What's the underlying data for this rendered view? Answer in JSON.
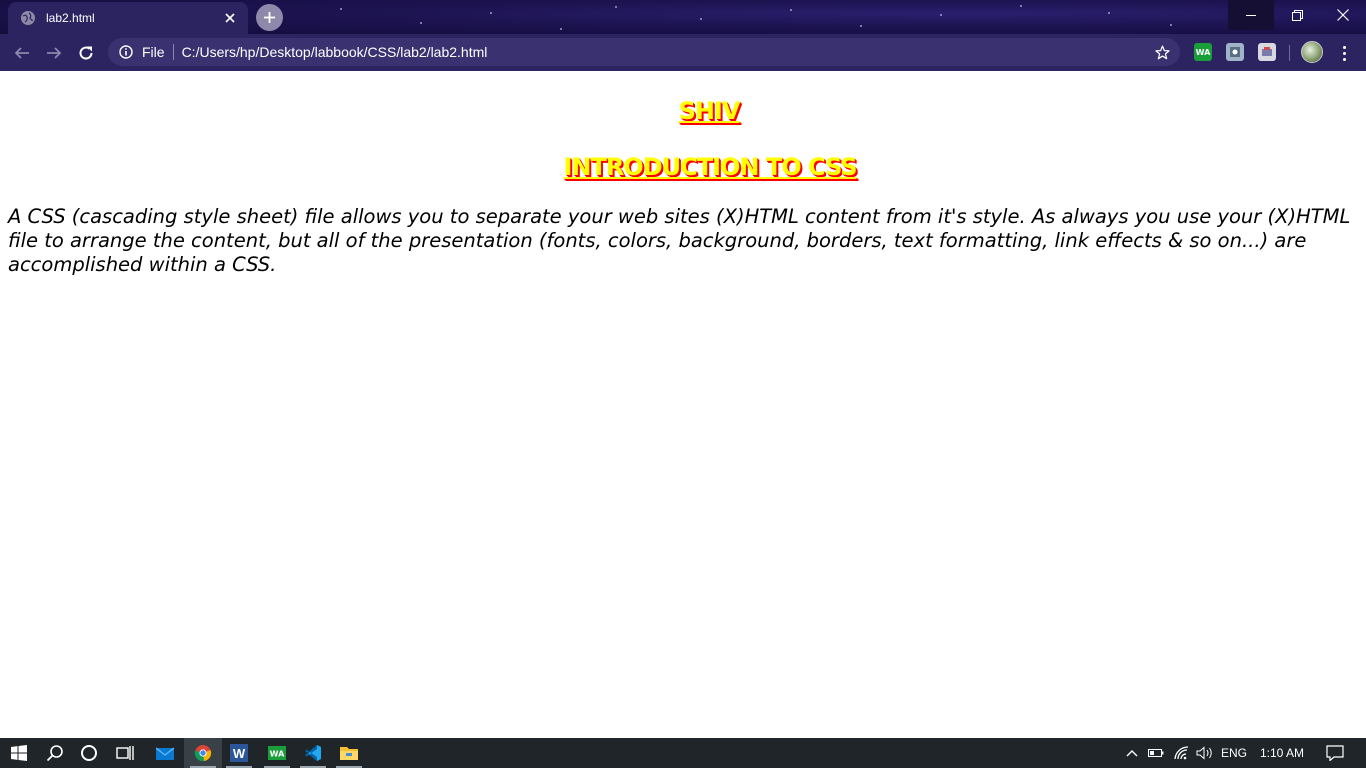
{
  "browser": {
    "tab_title": "lab2.html",
    "scheme_label": "File",
    "url": "C:/Users/hp/Desktop/labbook/CSS/lab2/lab2.html",
    "extensions": [
      {
        "name": "whatsapp-extension-icon",
        "label": "WA",
        "color": "#1a9e3a"
      },
      {
        "name": "tab-extension-icon",
        "label": "",
        "color": "#9fb4c8"
      },
      {
        "name": "cast-extension-icon",
        "label": "",
        "color": "#d8d8e0"
      }
    ]
  },
  "page": {
    "name_heading": "SHIV",
    "title_heading": "INTRODUCTION TO CSS",
    "paragraph": "A CSS (cascading style sheet) file allows you to separate your web sites (X)HTML content from it's style. As always you use your (X)HTML file to arrange the content, but all of the presentation (fonts, colors, background, borders, text formatting, link effects & so on...) are accomplished within a CSS.",
    "heading_color": "#ffff00",
    "heading_shadow_color": "#ff0000"
  },
  "taskbar": {
    "apps": [
      "windows-start-icon",
      "search-icon",
      "cortana-icon",
      "task-view-icon",
      "mail-icon",
      "chrome-icon",
      "word-icon",
      "whatsapp-icon",
      "vscode-icon",
      "file-explorer-icon"
    ],
    "language": "ENG",
    "time": "1:10 AM"
  }
}
